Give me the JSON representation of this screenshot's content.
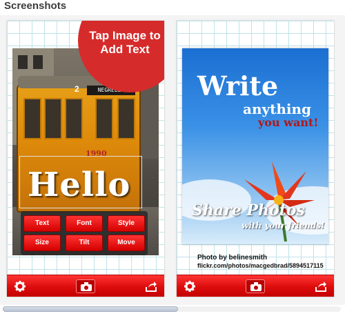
{
  "section": {
    "title": "Screenshots"
  },
  "screenshot_1": {
    "badge_text": "Tap Image to Add Text",
    "overlay_text": "Hello",
    "tram_sign": "NEGRELLI",
    "tram_number": "1990",
    "tram_route": "2",
    "controls": [
      "Text",
      "Font",
      "Style",
      "Size",
      "Tilt",
      "Move"
    ]
  },
  "screenshot_2": {
    "line_1": "Write",
    "line_2": "anything",
    "line_3": "you want!",
    "line_4": "Share Photos",
    "line_5": "with your friends!",
    "credit": "Photo by belinesmith",
    "credit_url": "flickr.com/photos/macgedbrad/5894517115"
  },
  "toolbar": {
    "icons": [
      "gear-icon",
      "camera-icon",
      "share-icon"
    ]
  },
  "colors": {
    "accent_red": "#d62b2b",
    "grid_line": "#bfe3ea"
  },
  "scrollbar": {
    "position_fraction": 0.0,
    "thumb_fraction": 0.52
  }
}
